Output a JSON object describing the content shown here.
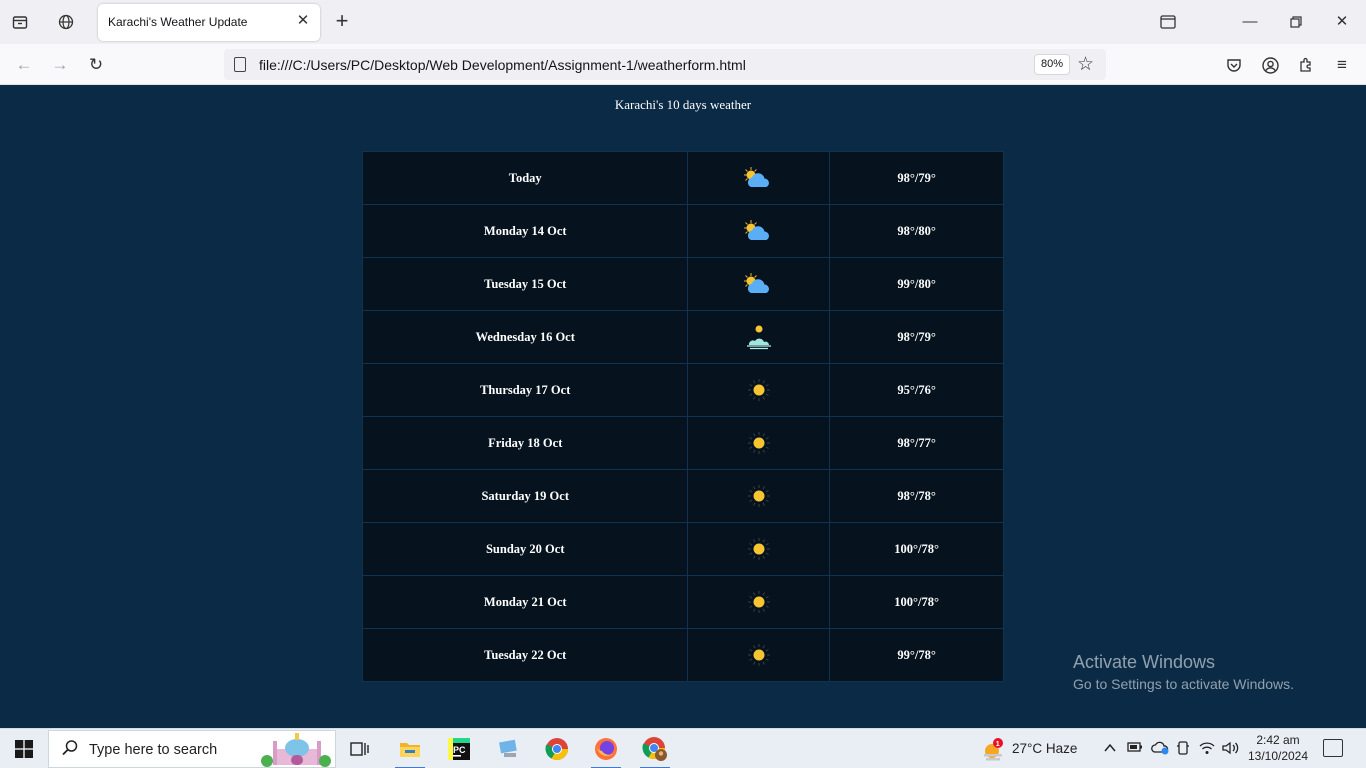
{
  "browser": {
    "tab_title": "Karachi's Weather Update",
    "url": "file:///C:/Users/PC/Desktop/Web Development/Assignment-1/weatherform.html",
    "zoom": "80%"
  },
  "page": {
    "heading": "Karachi's 10 days weather",
    "rows": [
      {
        "day": "Today",
        "icon": "partly-cloudy-icon",
        "temp": "98°/79°"
      },
      {
        "day": "Monday 14 Oct",
        "icon": "partly-cloudy-icon",
        "temp": "98°/80°"
      },
      {
        "day": "Tuesday 15 Oct",
        "icon": "partly-cloudy-icon",
        "temp": "99°/80°"
      },
      {
        "day": "Wednesday 16 Oct",
        "icon": "haze-sun-icon",
        "temp": "98°/79°"
      },
      {
        "day": "Thursday 17 Oct",
        "icon": "sunny-icon",
        "temp": "95°/76°"
      },
      {
        "day": "Friday 18 Oct",
        "icon": "sunny-icon",
        "temp": "98°/77°"
      },
      {
        "day": "Saturday 19 Oct",
        "icon": "sunny-icon",
        "temp": "98°/78°"
      },
      {
        "day": "Sunday 20 Oct",
        "icon": "sunny-icon",
        "temp": "100°/78°"
      },
      {
        "day": "Monday 21 Oct",
        "icon": "sunny-icon",
        "temp": "100°/78°"
      },
      {
        "day": "Tuesday 22 Oct",
        "icon": "sunny-icon",
        "temp": "99°/78°"
      }
    ]
  },
  "watermark": {
    "line1": "Activate Windows",
    "line2": "Go to Settings to activate Windows."
  },
  "taskbar": {
    "search_placeholder": "Type here to search",
    "weather": "27°C  Haze",
    "weather_badge": "1",
    "time": "2:42 am",
    "date": "13/10/2024"
  },
  "colors": {
    "page_bg": "#0b2a45",
    "table_bg": "#06131f",
    "sun": "#f7c531",
    "cloud": "#5aaef5"
  }
}
